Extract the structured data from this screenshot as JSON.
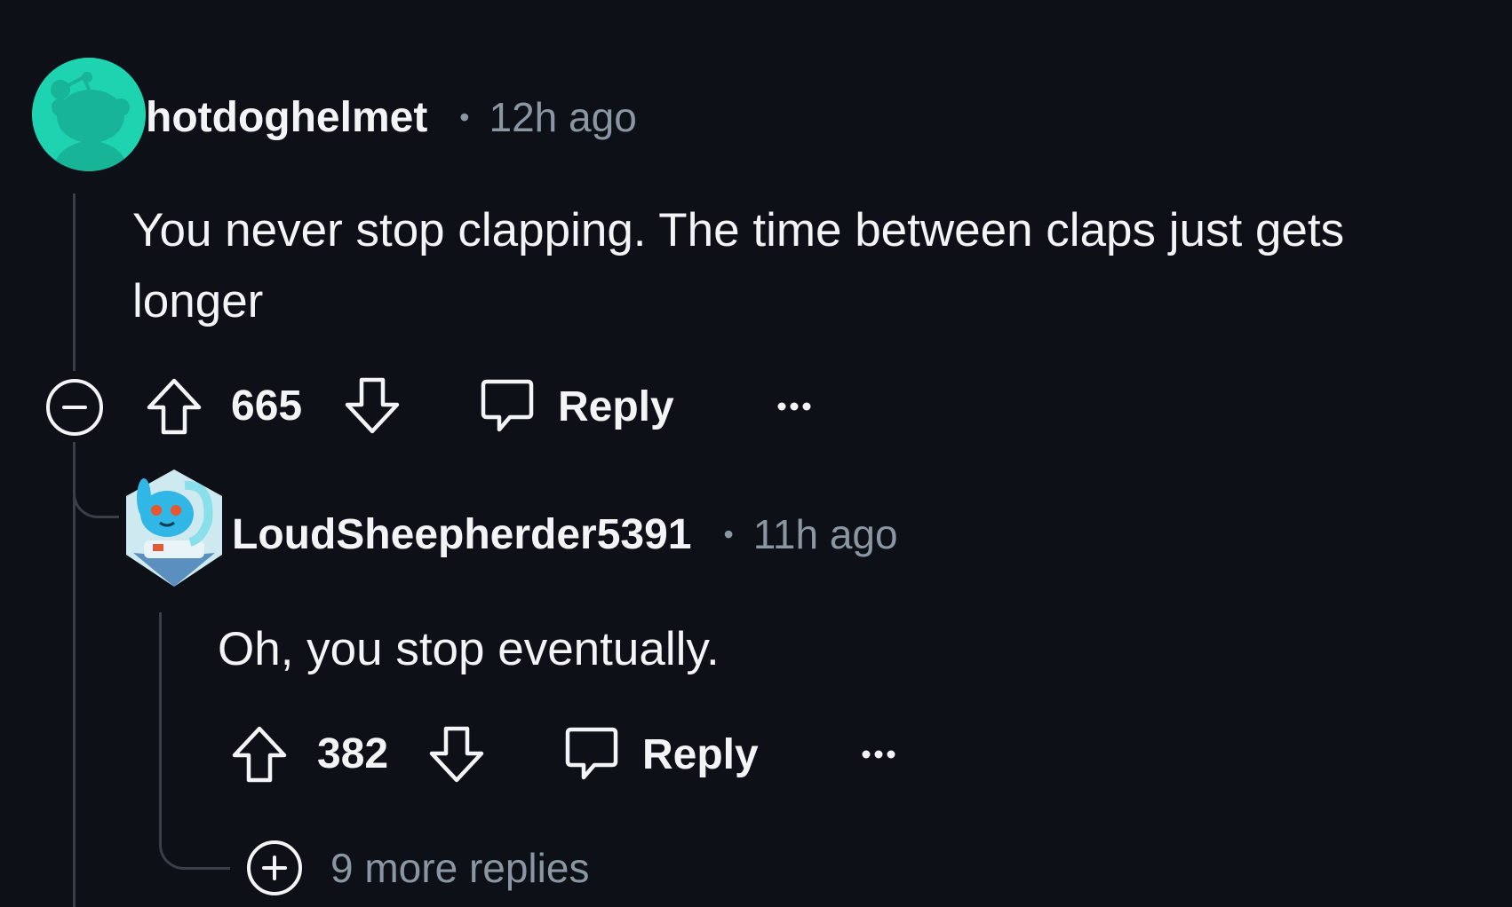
{
  "comments": [
    {
      "username": "hotdoghelmet",
      "separator": "•",
      "timestamp": "12h ago",
      "body_lines": [
        "You never stop clapping. The time between claps just gets",
        "longer"
      ],
      "votes": "665",
      "reply_label": "Reply",
      "avatar_color": "#1dd3b0"
    },
    {
      "username": "LoudSheepherder5391",
      "separator": "•",
      "timestamp": "11h ago",
      "body_lines": [
        "Oh, you stop eventually."
      ],
      "votes": "382",
      "reply_label": "Reply"
    }
  ],
  "more_replies": "9 more replies",
  "colors": {
    "background": "#0d1117",
    "text": "#f2f4f5",
    "muted": "#8b96a3",
    "thread_line": "#3a3f47"
  },
  "icons": {
    "collapse": "minus-circle-icon",
    "upvote": "arrow-up-outline-icon",
    "downvote": "arrow-down-outline-icon",
    "reply": "speech-bubble-icon",
    "overflow": "ellipsis-icon",
    "expand": "plus-circle-icon"
  }
}
